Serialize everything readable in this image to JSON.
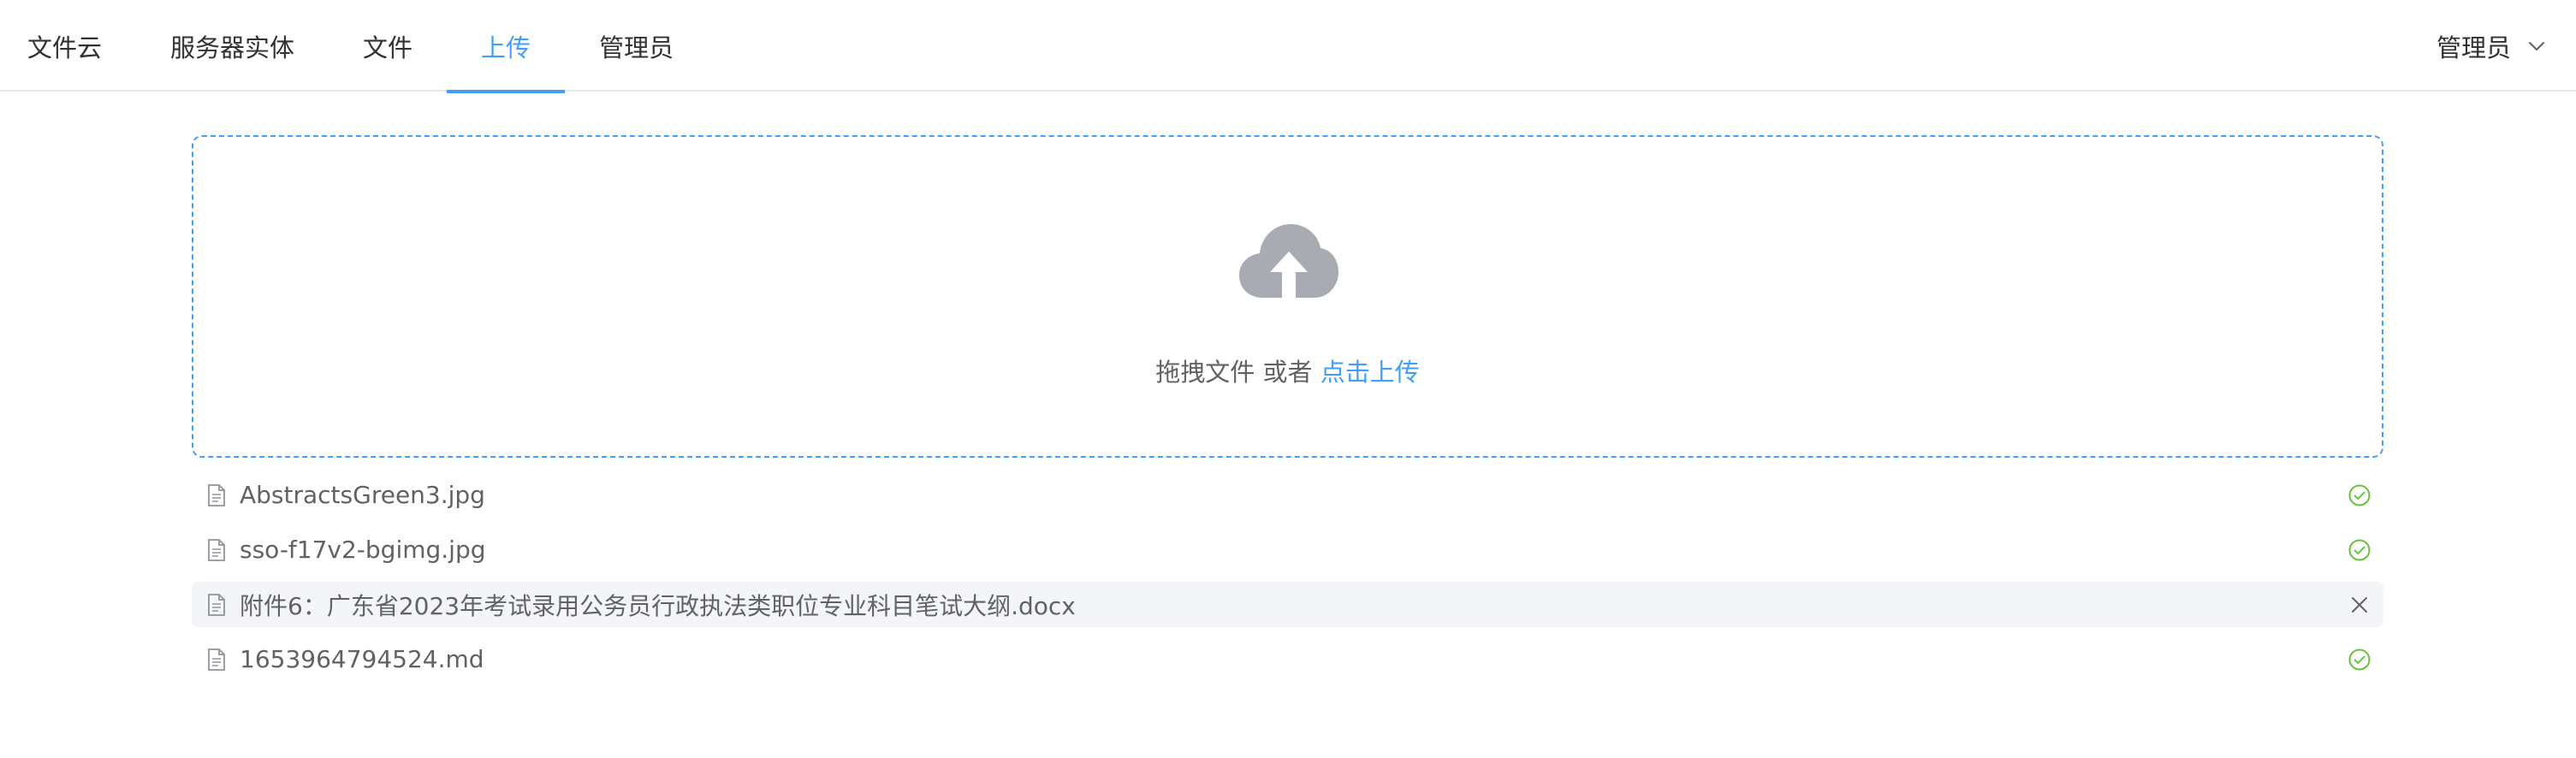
{
  "nav": {
    "items": [
      {
        "label": "文件云"
      },
      {
        "label": "服务器实体"
      },
      {
        "label": "文件"
      },
      {
        "label": "上传"
      },
      {
        "label": "管理员"
      }
    ],
    "active_index": 3
  },
  "user_menu": {
    "label": "管理员",
    "icon": "chevron-down-icon"
  },
  "upload": {
    "icon": "upload-cloud-icon",
    "prompt": "拖拽文件 或者 ",
    "link": "点击上传"
  },
  "files": [
    {
      "name": "AbstractsGreen3.jpg",
      "status": "success"
    },
    {
      "name": "sso-f17v2-bgimg.jpg",
      "status": "success"
    },
    {
      "name": "附件6：广东省2023年考试录用公务员行政执法类职位专业科目笔试大纲.docx",
      "status": "remove"
    },
    {
      "name": "1653964794524.md",
      "status": "success"
    }
  ],
  "colors": {
    "accent": "#409eff",
    "success": "#67c23a",
    "icon_gray": "#a8abb2",
    "hover_bg": "#f4f5f8"
  }
}
